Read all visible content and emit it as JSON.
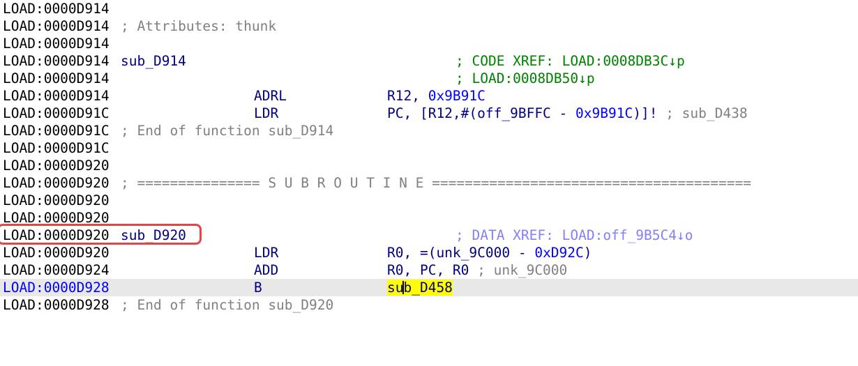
{
  "colors": {
    "background": "#ffffff",
    "text": "#000000",
    "name": "#000080",
    "number": "#0000ff",
    "comment": "#808080",
    "code_xref": "#008000",
    "data_xref": "#8080ff",
    "current_line_bg": "#e8e8e8",
    "highlight": "#ffff00",
    "annotation_box": "#e64545"
  },
  "lines": [
    {
      "addr": "LOAD:0000D914"
    },
    {
      "addr": "LOAD:0000D914",
      "comment": "; Attributes: thunk"
    },
    {
      "addr": "LOAD:0000D914"
    },
    {
      "addr": "LOAD:0000D914",
      "label": "sub_D914",
      "xref": "; CODE XREF: LOAD:0008DB3C↓p"
    },
    {
      "addr": "LOAD:0000D914",
      "xref": "; LOAD:0008DB50↓p"
    },
    {
      "addr": "LOAD:0000D914",
      "mnem": "ADRL",
      "op1": "R12, ",
      "op2": "0x9B91C"
    },
    {
      "addr": "LOAD:0000D91C",
      "mnem": "LDR",
      "op1": "PC, [R12,#(off_9BFFC - ",
      "op2": "0x9B91C",
      "op3": ")]! ",
      "op_comment": "; sub_D438"
    },
    {
      "addr": "LOAD:0000D91C",
      "comment": "; End of function sub_D914"
    },
    {
      "addr": "LOAD:0000D91C"
    },
    {
      "addr": "LOAD:0000D920"
    },
    {
      "addr": "LOAD:0000D920",
      "comment": "; =============== S U B R O U T I N E ======================================="
    },
    {
      "addr": "LOAD:0000D920"
    },
    {
      "addr": "LOAD:0000D920"
    },
    {
      "addr": "LOAD:0000D920",
      "label": "sub_D920",
      "xref": "; DATA XREF: LOAD:off_9B5C4↓o"
    },
    {
      "addr": "LOAD:0000D920",
      "mnem": "LDR",
      "op1": "R0, =(unk_9C000 - ",
      "op2": "0xD92C",
      "op3": ")"
    },
    {
      "addr": "LOAD:0000D924",
      "mnem": "ADD",
      "op1": "R0, PC, R0 ",
      "op_comment": "; unk_9C000"
    },
    {
      "addr": "LOAD:0000D928",
      "mnem": "B",
      "target_a": "su",
      "target_b": "b_D458"
    },
    {
      "addr": "LOAD:0000D928",
      "comment": "; End of function sub_D920"
    }
  ]
}
